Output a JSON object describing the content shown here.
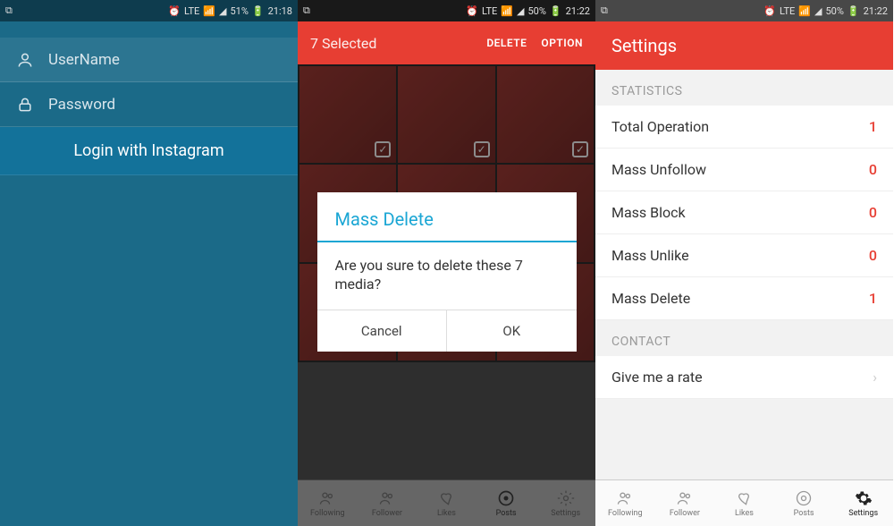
{
  "status": {
    "lte": "LTE",
    "wifi": "⧋",
    "signal": "▭◢",
    "s1_batt": "51%",
    "s1_time": "21:18",
    "s2_batt": "50%",
    "s2_time": "21:22",
    "s3_batt": "50%",
    "s3_time": "21:22"
  },
  "login": {
    "username_ph": "UserName",
    "password_ph": "Password",
    "button": "Login with Instagram"
  },
  "posts": {
    "title": "7 Selected",
    "delete": "DELETE",
    "option": "OPTION"
  },
  "dialog": {
    "title": "Mass Delete",
    "msg": "Are you sure to delete these 7 media?",
    "cancel": "Cancel",
    "ok": "OK"
  },
  "nav": {
    "following": "Following",
    "follower": "Follower",
    "likes": "Likes",
    "posts": "Posts",
    "settings": "Settings"
  },
  "settings": {
    "title": "Settings",
    "stats_header": "STATISTICS",
    "rows": [
      {
        "label": "Total Operation",
        "val": "1"
      },
      {
        "label": "Mass Unfollow",
        "val": "0"
      },
      {
        "label": "Mass Block",
        "val": "0"
      },
      {
        "label": "Mass Unlike",
        "val": "0"
      },
      {
        "label": "Mass Delete",
        "val": "1"
      }
    ],
    "contact_header": "CONTACT",
    "rate": "Give me a rate"
  }
}
